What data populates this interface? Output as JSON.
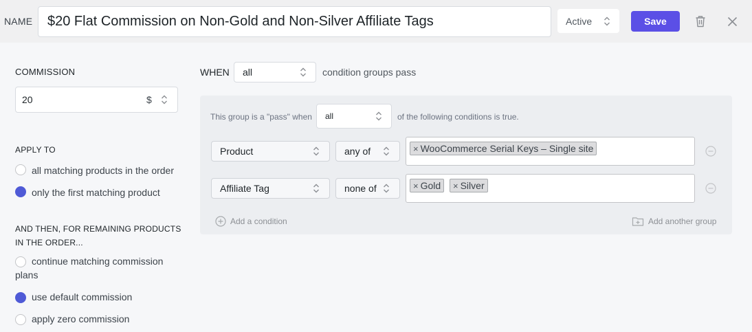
{
  "header": {
    "name_label": "NAME",
    "name_value": "$20 Flat Commission on Non-Gold and Non-Silver Affiliate Tags",
    "status_value": "Active",
    "save_label": "Save"
  },
  "commission": {
    "label": "COMMISSION",
    "value": "20",
    "currency": "$"
  },
  "apply_to": {
    "label": "APPLY TO",
    "options": [
      {
        "label": "all matching products in the order",
        "checked": false
      },
      {
        "label": "only the first matching product",
        "checked": true
      }
    ]
  },
  "and_then": {
    "label_line1": "AND THEN, FOR REMAINING PRODUCTS",
    "label_line2": "IN THE ORDER...",
    "options": [
      {
        "label_line1": "continue matching commission",
        "label_line2": "plans",
        "checked": false
      },
      {
        "label": "use default commission",
        "checked": true
      },
      {
        "label": "apply zero commission",
        "checked": false
      }
    ]
  },
  "when": {
    "label": "WHEN",
    "value": "all",
    "suffix": "condition groups pass"
  },
  "group": {
    "prefix": "This group is a \"pass\" when",
    "value": "all",
    "suffix": "of the following conditions is true.",
    "conditions": [
      {
        "field": "Product",
        "operator": "any of",
        "tags": [
          "WooCommerce Serial Keys – Single site"
        ]
      },
      {
        "field": "Affiliate Tag",
        "operator": "none of",
        "tags": [
          "Gold",
          "Silver"
        ]
      }
    ],
    "add_condition_label": "Add a condition",
    "add_group_label": "Add another group"
  },
  "colors": {
    "accent": "#5b4fe6",
    "radio_checked": "#4f5ad6"
  }
}
